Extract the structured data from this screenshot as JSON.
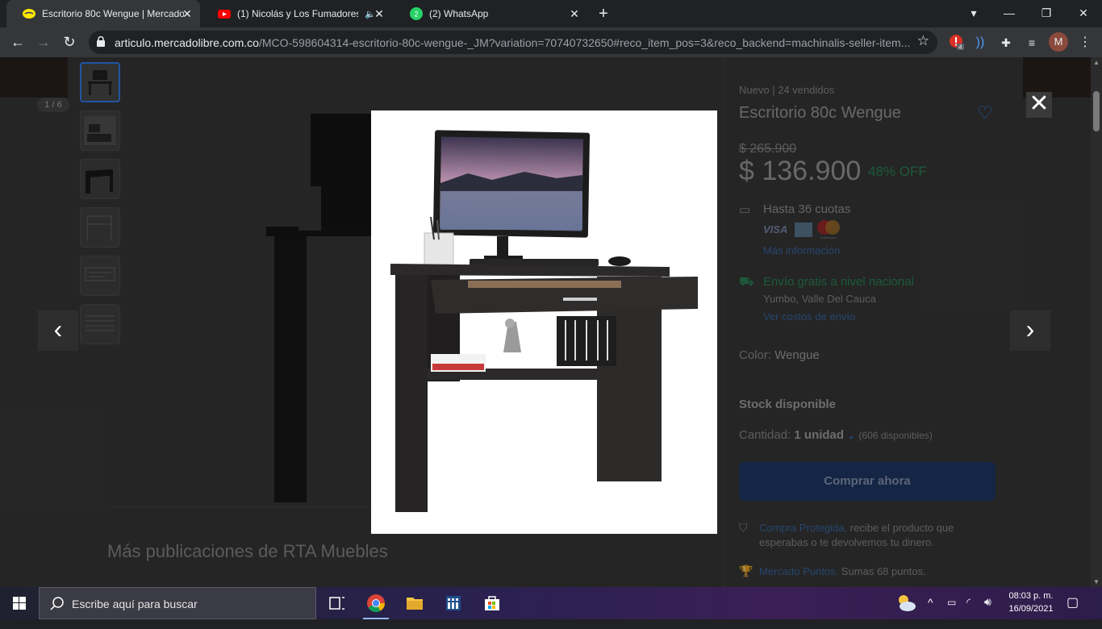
{
  "browser": {
    "tabs": [
      {
        "title": "Escritorio 80c Wengue | Mercado",
        "active": true,
        "icon": "mercadolibre-icon"
      },
      {
        "title": "(1) Nicolás y Los Fumadores",
        "active": false,
        "icon": "youtube-icon",
        "audio": true
      },
      {
        "title": "(2) WhatsApp",
        "active": false,
        "icon": "whatsapp-icon"
      }
    ],
    "url_host": "articulo.mercadolibre.com.co",
    "url_path": "/MCO-598604314-escritorio-80c-wengue-_JM?variation=70740732650#reco_item_pos=3&reco_backend=machinalis-seller-item...",
    "extension_badge": "4",
    "profile_initial": "M"
  },
  "gallery": {
    "counter": "1 / 6",
    "thumbnails": [
      "desk",
      "desk-room",
      "desk-plain",
      "desk-drawing",
      "desk-label",
      "desk-list"
    ],
    "close_symbol": "✕",
    "prev_symbol": "‹",
    "next_symbol": "›"
  },
  "product": {
    "condition": "Nuevo",
    "sold": "24 vendidos",
    "title": "Escritorio 80c Wengue",
    "old_price": "$ 265.900",
    "price": "$ 136.900",
    "discount": "48% OFF",
    "installments": "Hasta 36 cuotas",
    "card_visa": "VISA",
    "card_mc": "mastercard",
    "more_info": "Más información",
    "shipping": "Envío gratis a nivel nacional",
    "location": "Yumbo, Valle Del Cauca",
    "shipping_costs": "Ver costos de envío",
    "color_label": "Color:",
    "color_value": "Wengue",
    "stock": "Stock disponible",
    "qty_label": "Cantidad:",
    "qty_value": "1 unidad",
    "available": "(606 disponibles)",
    "buy_button": "Comprar ahora",
    "protected_link": "Compra Protegida,",
    "protected_text": "recibe el producto que esperabas o te devolvemos tu dinero.",
    "points_link": "Mercado Puntos.",
    "points_text": "Sumas 68 puntos."
  },
  "more_pubs": "Más publicaciones de RTA Muebles",
  "taskbar": {
    "search_placeholder": "Escribe aquí para buscar",
    "time": "08:03 p. m.",
    "date": "16/09/2021"
  },
  "colors": {
    "accent_blue": "#3483fa",
    "green": "#00a650"
  }
}
